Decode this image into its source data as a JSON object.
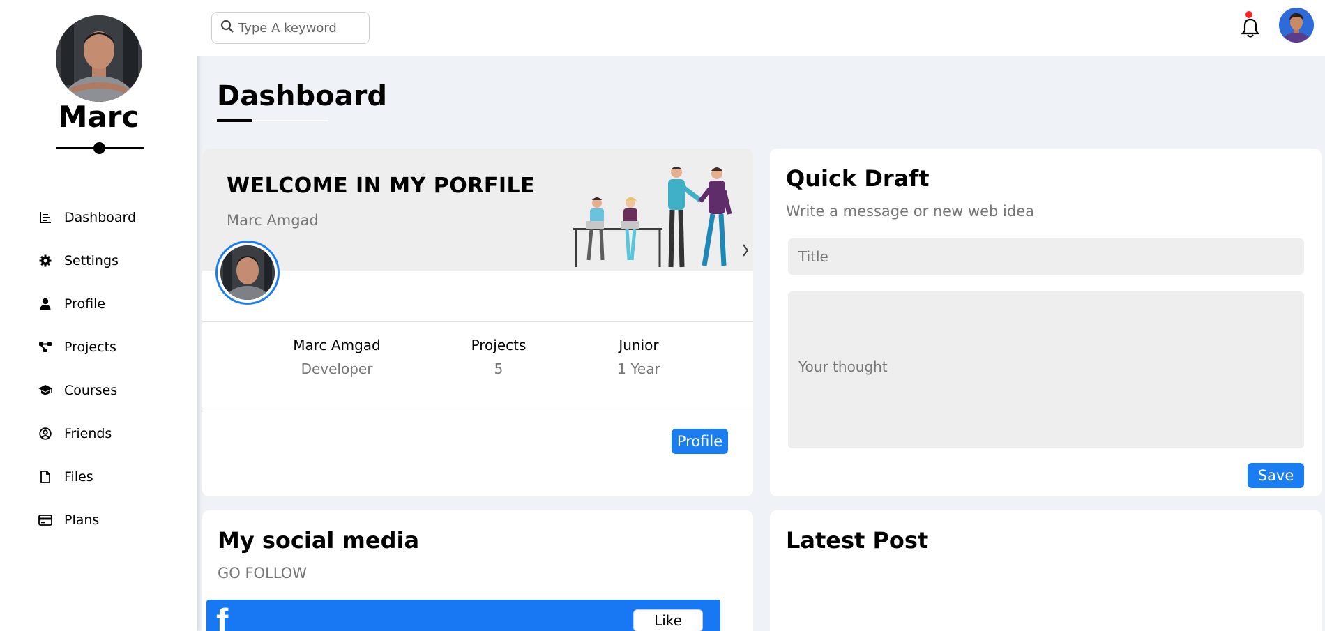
{
  "sidebar": {
    "name": "Marc",
    "items": [
      {
        "label": "Dashboard",
        "icon": "chart-bar-icon"
      },
      {
        "label": "Settings",
        "icon": "gear-icon"
      },
      {
        "label": "Profile",
        "icon": "user-icon"
      },
      {
        "label": "Projects",
        "icon": "diagram-icon"
      },
      {
        "label": "Courses",
        "icon": "graduation-cap-icon"
      },
      {
        "label": "Friends",
        "icon": "user-circle-icon"
      },
      {
        "label": "Files",
        "icon": "file-icon"
      },
      {
        "label": "Plans",
        "icon": "credit-card-icon"
      }
    ]
  },
  "topbar": {
    "search_placeholder": "Type A keyword",
    "notification_active": true
  },
  "page": {
    "title": "Dashboard"
  },
  "welcome": {
    "title": "WELCOME IN MY PORFILE",
    "subtitle": "Marc Amgad",
    "stats": [
      {
        "key": "Marc Amgad",
        "value": "Developer"
      },
      {
        "key": "Projects",
        "value": "5"
      },
      {
        "key": "Junior",
        "value": "1 Year"
      }
    ],
    "profile_button": "Profile"
  },
  "draft": {
    "title": "Quick Draft",
    "subtitle": "Write a message or new web idea",
    "title_placeholder": "Title",
    "body_placeholder": "Your thought",
    "save_button": "Save"
  },
  "social": {
    "title": "My social media",
    "subtitle": "GO FOLLOW",
    "facebook_logo": "f",
    "like_button": "Like"
  },
  "latest_post": {
    "title": "Latest Post"
  },
  "colors": {
    "accent": "#1a7ef2",
    "facebook": "#1877f2",
    "background": "#eff2f6",
    "notification_dot": "#ff2020"
  }
}
